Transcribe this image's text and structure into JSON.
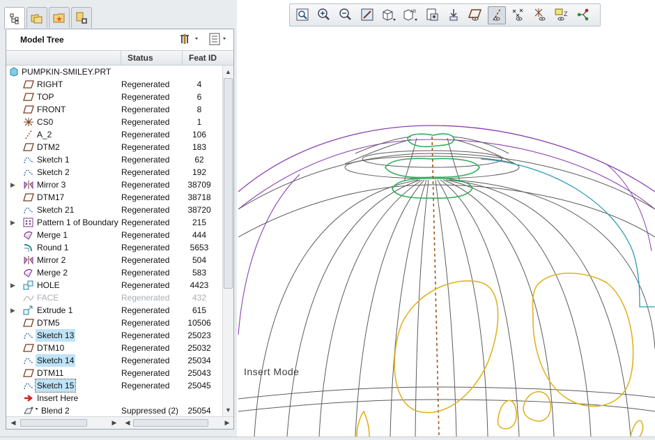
{
  "navigator": {
    "tabs": [
      {
        "icon": "model-tree-icon"
      },
      {
        "icon": "folder-browser-icon"
      },
      {
        "icon": "favorites-icon"
      },
      {
        "icon": "connections-icon"
      }
    ]
  },
  "model_tree": {
    "title": "Model Tree",
    "settings_icon": "tree-settings-icon",
    "filter_icon": "show-columns-icon",
    "columns": {
      "status": "Status",
      "feat_id": "Feat ID"
    },
    "root": {
      "name": "PUMPKIN-SMILEY.PRT",
      "icon": "part-icon"
    },
    "rows": [
      {
        "name": "RIGHT",
        "status": "Regenerated",
        "id": "4",
        "icon": "datum-plane-icon"
      },
      {
        "name": "TOP",
        "status": "Regenerated",
        "id": "6",
        "icon": "datum-plane-icon"
      },
      {
        "name": "FRONT",
        "status": "Regenerated",
        "id": "8",
        "icon": "datum-plane-icon"
      },
      {
        "name": "CS0",
        "status": "Regenerated",
        "id": "1",
        "icon": "coordinate-system-icon"
      },
      {
        "name": "A_2",
        "status": "Regenerated",
        "id": "106",
        "icon": "datum-axis-icon"
      },
      {
        "name": "DTM2",
        "status": "Regenerated",
        "id": "183",
        "icon": "datum-plane-icon"
      },
      {
        "name": "Sketch 1",
        "status": "Regenerated",
        "id": "62",
        "icon": "sketch-icon"
      },
      {
        "name": "Sketch 2",
        "status": "Regenerated",
        "id": "192",
        "icon": "sketch-icon"
      },
      {
        "name": "Mirror 3",
        "status": "Regenerated",
        "id": "38709",
        "icon": "mirror-icon",
        "expandable": true
      },
      {
        "name": "DTM17",
        "status": "Regenerated",
        "id": "38718",
        "icon": "datum-plane-icon"
      },
      {
        "name": "Sketch 21",
        "status": "Regenerated",
        "id": "38720",
        "icon": "sketch-icon"
      },
      {
        "name": "Pattern 1 of Boundary",
        "status": "Regenerated",
        "id": "215",
        "icon": "pattern-icon",
        "expandable": true
      },
      {
        "name": "Merge 1",
        "status": "Regenerated",
        "id": "444",
        "icon": "merge-icon"
      },
      {
        "name": "Round 1",
        "status": "Regenerated",
        "id": "5653",
        "icon": "round-icon"
      },
      {
        "name": "Mirror 2",
        "status": "Regenerated",
        "id": "504",
        "icon": "mirror-icon"
      },
      {
        "name": "Merge 2",
        "status": "Regenerated",
        "id": "583",
        "icon": "merge-icon"
      },
      {
        "name": "HOLE",
        "status": "Regenerated",
        "id": "4423",
        "icon": "group-icon",
        "expandable": true
      },
      {
        "name": "FACE",
        "status": "Regenerated",
        "id": "432",
        "icon": "surface-icon",
        "dim": true
      },
      {
        "name": "Extrude 1",
        "status": "Regenerated",
        "id": "615",
        "icon": "extrude-icon",
        "expandable": true
      },
      {
        "name": "DTM5",
        "status": "Regenerated",
        "id": "10506",
        "icon": "datum-plane-icon"
      },
      {
        "name": "Sketch 13",
        "status": "Regenerated",
        "id": "25023",
        "icon": "sketch-icon",
        "highlight": true
      },
      {
        "name": "DTM10",
        "status": "Regenerated",
        "id": "25032",
        "icon": "datum-plane-icon"
      },
      {
        "name": "Sketch 14",
        "status": "Regenerated",
        "id": "25034",
        "icon": "sketch-icon",
        "highlight": true
      },
      {
        "name": "DTM11",
        "status": "Regenerated",
        "id": "25043",
        "icon": "datum-plane-icon"
      },
      {
        "name": "Sketch 15",
        "status": "Regenerated",
        "id": "25045",
        "icon": "sketch-icon",
        "selected": true
      },
      {
        "name": "Insert Here",
        "status": "",
        "id": "",
        "icon": "insert-arrow-icon"
      },
      {
        "name": "Blend 2",
        "status": "Suppressed (2)",
        "id": "25054",
        "icon": "blend-icon",
        "suppressed": true
      }
    ]
  },
  "toolbar": {
    "buttons": [
      {
        "name": "refit-button",
        "icon": "refit-icon"
      },
      {
        "name": "zoom-in-button",
        "icon": "zoom-in-icon"
      },
      {
        "name": "zoom-out-button",
        "icon": "zoom-out-icon"
      },
      {
        "name": "repaint-button",
        "icon": "repaint-icon"
      },
      {
        "name": "display-style-button",
        "icon": "display-style-icon"
      },
      {
        "name": "saved-orientations-button",
        "icon": "saved-views-icon"
      },
      {
        "name": "view-manager-button",
        "icon": "view-manager-icon"
      },
      {
        "name": "spin-center-button",
        "icon": "spin-center-icon"
      },
      {
        "name": "plane-display-button",
        "icon": "plane-display-icon"
      },
      {
        "name": "axis-display-button",
        "icon": "axis-display-icon"
      },
      {
        "name": "point-display-button",
        "icon": "point-display-icon"
      },
      {
        "name": "csys-display-button",
        "icon": "csys-display-icon"
      },
      {
        "name": "annotation-display-button",
        "icon": "annotation-display-icon"
      },
      {
        "name": "simulation-display-button",
        "icon": "simulation-display-icon"
      }
    ]
  },
  "graphics": {
    "status_text": "Insert Mode",
    "colors": {
      "wire": "#5a5a5a",
      "silhouette": "#8a3fb0",
      "green_curve": "#2eae5a",
      "yellow_curve": "#e0b21e",
      "axis": "#a0521a",
      "teal_curve": "#2a9bb3"
    }
  }
}
